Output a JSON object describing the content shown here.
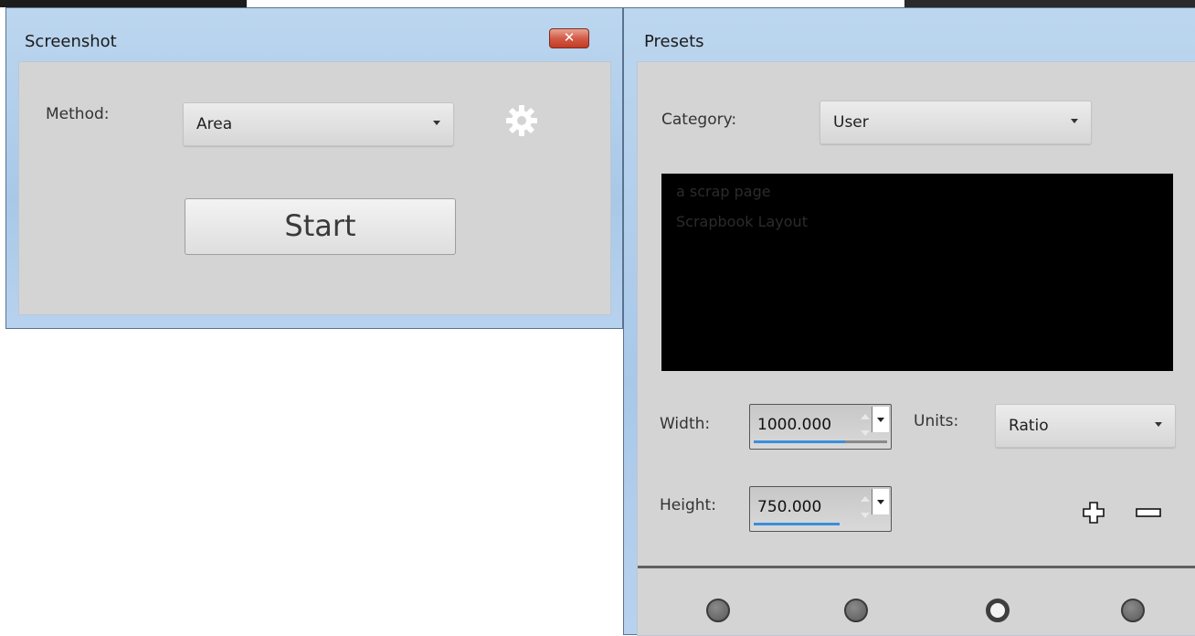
{
  "screenshot_window": {
    "title": "Screenshot",
    "close_glyph": "✕",
    "method_label": "Method:",
    "method_value": "Area",
    "start_label": "Start",
    "settings_icon": "gear-icon"
  },
  "presets_window": {
    "title": "Presets",
    "category_label": "Category:",
    "category_value": "User",
    "preset_items": [
      "a scrap page",
      "Scrapbook Layout"
    ],
    "width_label": "Width:",
    "width_value": "1000.000",
    "units_label": "Units:",
    "units_value": "Ratio",
    "height_label": "Height:",
    "height_value": "750.000",
    "add_icon": "plus-icon",
    "remove_icon": "minus-icon",
    "dots": [
      {
        "name": "dot-1",
        "selected": false
      },
      {
        "name": "dot-2",
        "selected": false
      },
      {
        "name": "dot-3",
        "selected": true
      },
      {
        "name": "dot-4",
        "selected": false
      }
    ]
  },
  "colors": {
    "titlebar": "#a9c8e8",
    "client_bg": "#d4d4d4",
    "list_bg": "#000000",
    "accent": "#3a8fdc",
    "close_red": "#c23b26"
  }
}
